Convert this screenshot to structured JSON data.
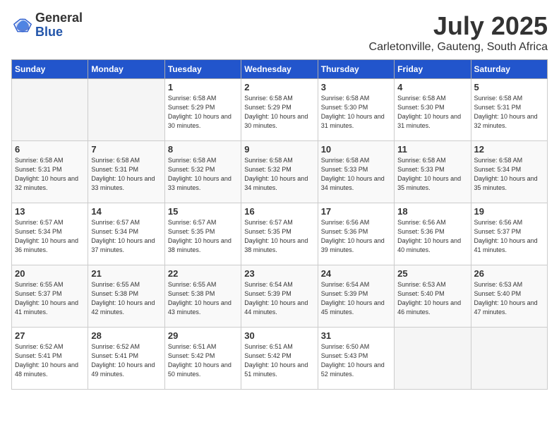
{
  "logo": {
    "general": "General",
    "blue": "Blue"
  },
  "title": "July 2025",
  "subtitle": "Carletonville, Gauteng, South Africa",
  "days_of_week": [
    "Sunday",
    "Monday",
    "Tuesday",
    "Wednesday",
    "Thursday",
    "Friday",
    "Saturday"
  ],
  "weeks": [
    [
      {
        "day": "",
        "info": ""
      },
      {
        "day": "",
        "info": ""
      },
      {
        "day": "1",
        "info": "Sunrise: 6:58 AM\nSunset: 5:29 PM\nDaylight: 10 hours and 30 minutes."
      },
      {
        "day": "2",
        "info": "Sunrise: 6:58 AM\nSunset: 5:29 PM\nDaylight: 10 hours and 30 minutes."
      },
      {
        "day": "3",
        "info": "Sunrise: 6:58 AM\nSunset: 5:30 PM\nDaylight: 10 hours and 31 minutes."
      },
      {
        "day": "4",
        "info": "Sunrise: 6:58 AM\nSunset: 5:30 PM\nDaylight: 10 hours and 31 minutes."
      },
      {
        "day": "5",
        "info": "Sunrise: 6:58 AM\nSunset: 5:31 PM\nDaylight: 10 hours and 32 minutes."
      }
    ],
    [
      {
        "day": "6",
        "info": "Sunrise: 6:58 AM\nSunset: 5:31 PM\nDaylight: 10 hours and 32 minutes."
      },
      {
        "day": "7",
        "info": "Sunrise: 6:58 AM\nSunset: 5:31 PM\nDaylight: 10 hours and 33 minutes."
      },
      {
        "day": "8",
        "info": "Sunrise: 6:58 AM\nSunset: 5:32 PM\nDaylight: 10 hours and 33 minutes."
      },
      {
        "day": "9",
        "info": "Sunrise: 6:58 AM\nSunset: 5:32 PM\nDaylight: 10 hours and 34 minutes."
      },
      {
        "day": "10",
        "info": "Sunrise: 6:58 AM\nSunset: 5:33 PM\nDaylight: 10 hours and 34 minutes."
      },
      {
        "day": "11",
        "info": "Sunrise: 6:58 AM\nSunset: 5:33 PM\nDaylight: 10 hours and 35 minutes."
      },
      {
        "day": "12",
        "info": "Sunrise: 6:58 AM\nSunset: 5:34 PM\nDaylight: 10 hours and 35 minutes."
      }
    ],
    [
      {
        "day": "13",
        "info": "Sunrise: 6:57 AM\nSunset: 5:34 PM\nDaylight: 10 hours and 36 minutes."
      },
      {
        "day": "14",
        "info": "Sunrise: 6:57 AM\nSunset: 5:34 PM\nDaylight: 10 hours and 37 minutes."
      },
      {
        "day": "15",
        "info": "Sunrise: 6:57 AM\nSunset: 5:35 PM\nDaylight: 10 hours and 38 minutes."
      },
      {
        "day": "16",
        "info": "Sunrise: 6:57 AM\nSunset: 5:35 PM\nDaylight: 10 hours and 38 minutes."
      },
      {
        "day": "17",
        "info": "Sunrise: 6:56 AM\nSunset: 5:36 PM\nDaylight: 10 hours and 39 minutes."
      },
      {
        "day": "18",
        "info": "Sunrise: 6:56 AM\nSunset: 5:36 PM\nDaylight: 10 hours and 40 minutes."
      },
      {
        "day": "19",
        "info": "Sunrise: 6:56 AM\nSunset: 5:37 PM\nDaylight: 10 hours and 41 minutes."
      }
    ],
    [
      {
        "day": "20",
        "info": "Sunrise: 6:55 AM\nSunset: 5:37 PM\nDaylight: 10 hours and 41 minutes."
      },
      {
        "day": "21",
        "info": "Sunrise: 6:55 AM\nSunset: 5:38 PM\nDaylight: 10 hours and 42 minutes."
      },
      {
        "day": "22",
        "info": "Sunrise: 6:55 AM\nSunset: 5:38 PM\nDaylight: 10 hours and 43 minutes."
      },
      {
        "day": "23",
        "info": "Sunrise: 6:54 AM\nSunset: 5:39 PM\nDaylight: 10 hours and 44 minutes."
      },
      {
        "day": "24",
        "info": "Sunrise: 6:54 AM\nSunset: 5:39 PM\nDaylight: 10 hours and 45 minutes."
      },
      {
        "day": "25",
        "info": "Sunrise: 6:53 AM\nSunset: 5:40 PM\nDaylight: 10 hours and 46 minutes."
      },
      {
        "day": "26",
        "info": "Sunrise: 6:53 AM\nSunset: 5:40 PM\nDaylight: 10 hours and 47 minutes."
      }
    ],
    [
      {
        "day": "27",
        "info": "Sunrise: 6:52 AM\nSunset: 5:41 PM\nDaylight: 10 hours and 48 minutes."
      },
      {
        "day": "28",
        "info": "Sunrise: 6:52 AM\nSunset: 5:41 PM\nDaylight: 10 hours and 49 minutes."
      },
      {
        "day": "29",
        "info": "Sunrise: 6:51 AM\nSunset: 5:42 PM\nDaylight: 10 hours and 50 minutes."
      },
      {
        "day": "30",
        "info": "Sunrise: 6:51 AM\nSunset: 5:42 PM\nDaylight: 10 hours and 51 minutes."
      },
      {
        "day": "31",
        "info": "Sunrise: 6:50 AM\nSunset: 5:43 PM\nDaylight: 10 hours and 52 minutes."
      },
      {
        "day": "",
        "info": ""
      },
      {
        "day": "",
        "info": ""
      }
    ]
  ]
}
